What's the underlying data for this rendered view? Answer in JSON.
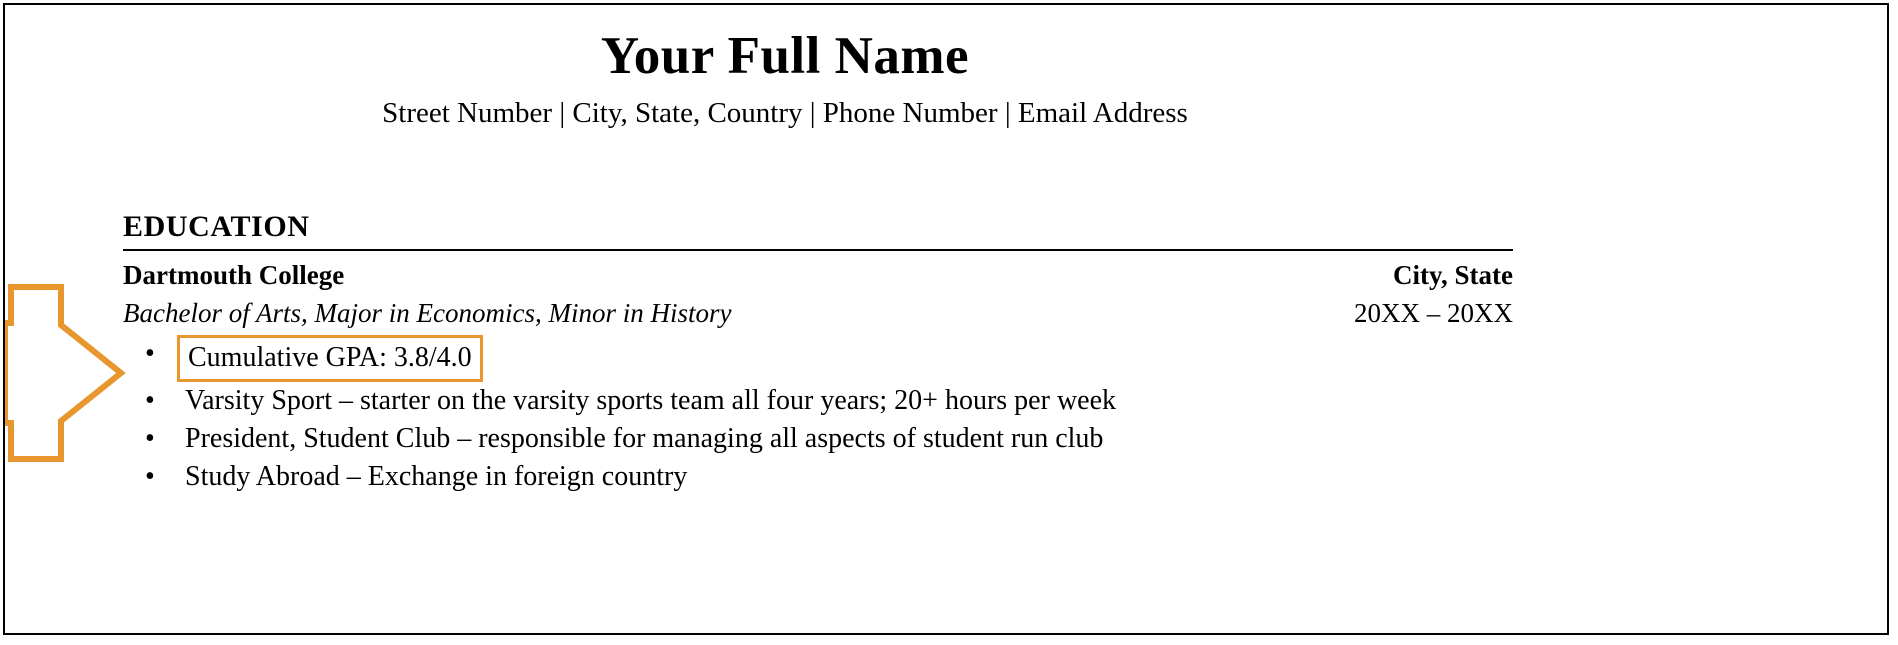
{
  "document": {
    "kind": "resume-education-section-example",
    "accent_color": "#e8972f",
    "text_color": "#000000",
    "border_color": "#000000",
    "header": {
      "name": "Your Full Name",
      "contact_line": "Street Number | City, State, Country | Phone Number | Email Address"
    },
    "section": {
      "heading": "EDUCATION",
      "entry": {
        "school": "Dartmouth College",
        "location": "City, State",
        "degree": "Bachelor of Arts, Major in Economics, Minor in History",
        "dates": "20XX – 20XX",
        "bullets": [
          {
            "text": "Cumulative GPA: 3.8/4.0",
            "highlighted": true
          },
          {
            "text": "Varsity Sport – starter on the varsity sports team all four years; 20+ hours per week",
            "highlighted": false
          },
          {
            "text": "President, Student Club – responsible for managing all aspects of student run club",
            "highlighted": false
          },
          {
            "text": "Study Abroad – Exchange in foreign country",
            "highlighted": false
          }
        ]
      }
    },
    "annotation": {
      "type": "arrow",
      "direction": "right",
      "color": "#e8972f",
      "points_at": "Cumulative GPA: 3.8/4.0"
    },
    "bullet_glyph": "•"
  }
}
